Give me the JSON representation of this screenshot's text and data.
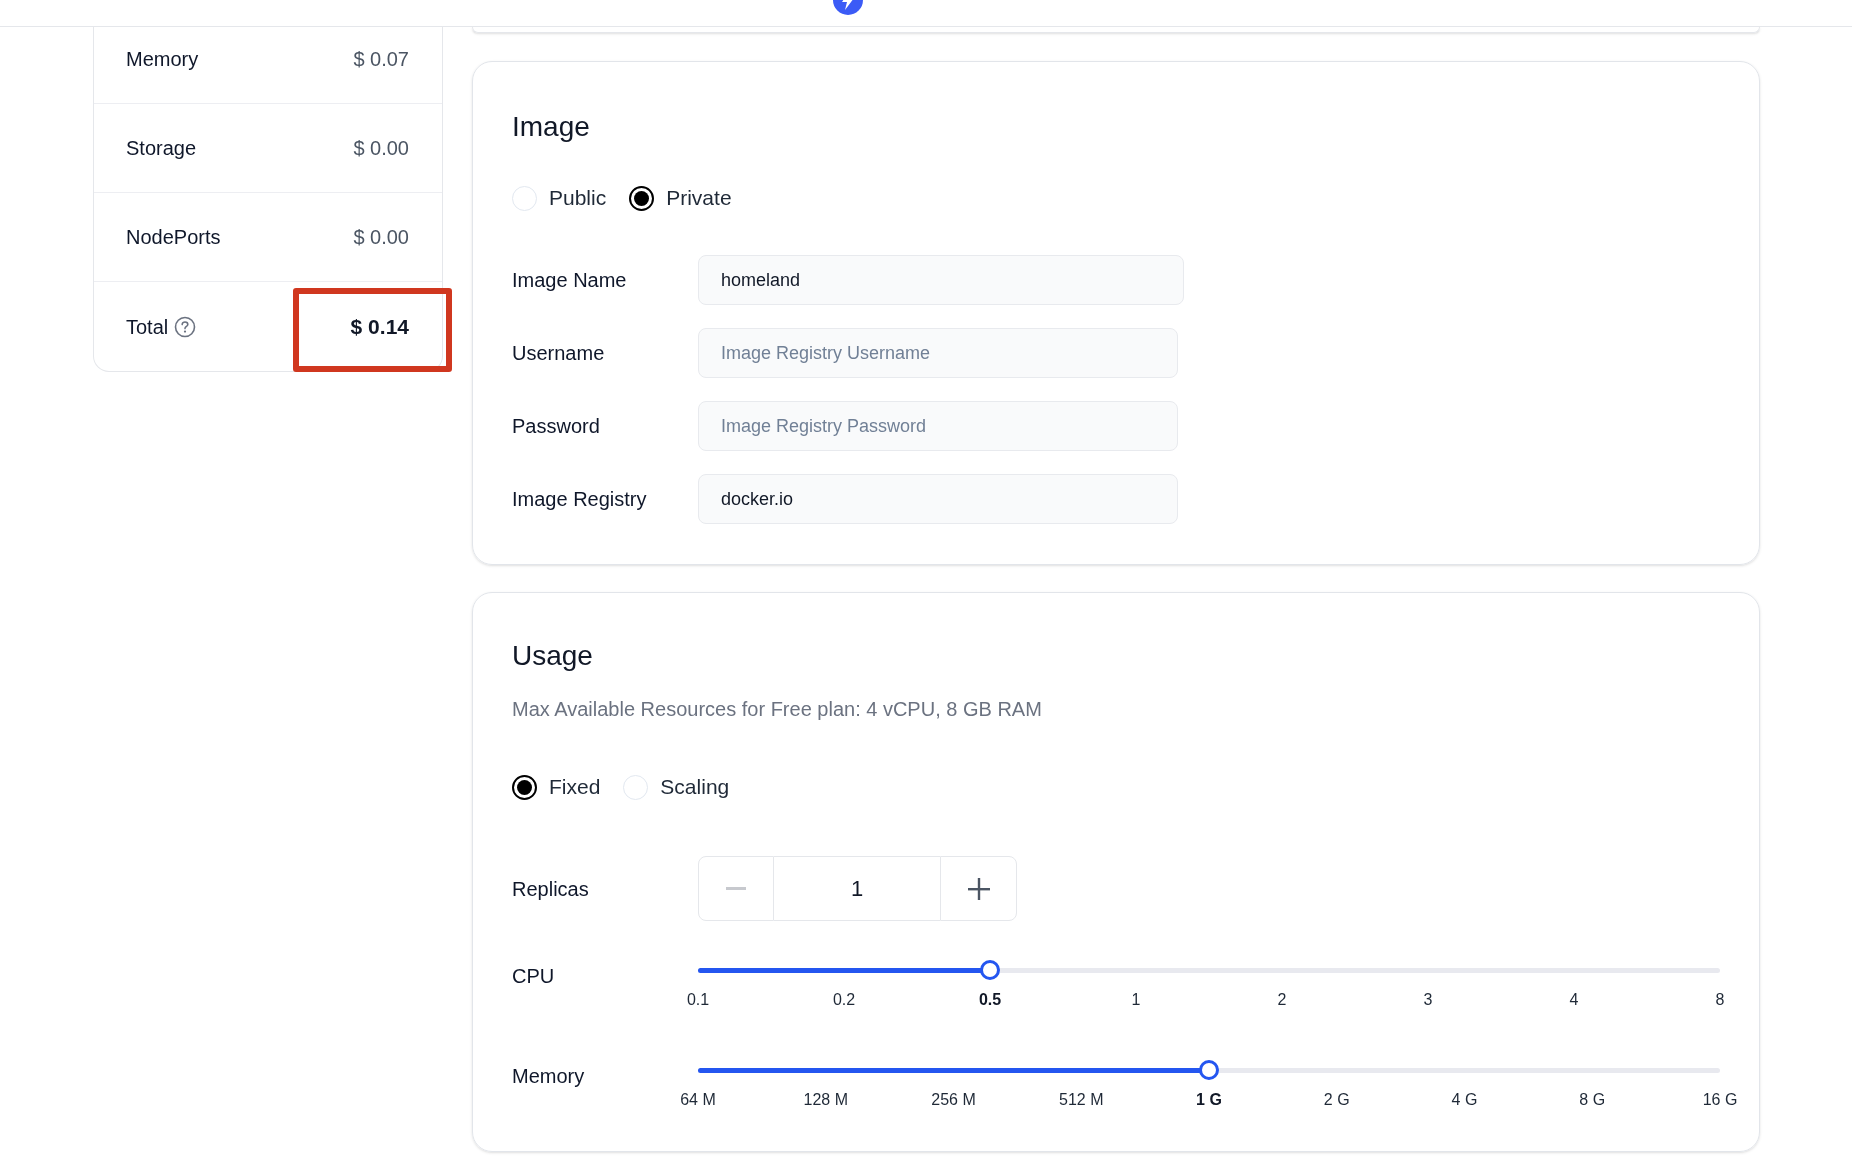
{
  "price_panel": {
    "rows": [
      {
        "label": "Memory",
        "value": "$ 0.07"
      },
      {
        "label": "Storage",
        "value": "$ 0.00"
      },
      {
        "label": "NodePorts",
        "value": "$ 0.00"
      }
    ],
    "total": {
      "label": "Total",
      "value": "$ 0.14",
      "highlighted": true
    }
  },
  "image_card": {
    "title": "Image",
    "access_options": [
      {
        "label": "Public",
        "selected": false
      },
      {
        "label": "Private",
        "selected": true
      }
    ],
    "fields": [
      {
        "label": "Image Name",
        "value": "homeland"
      },
      {
        "label": "Username",
        "placeholder": "Image Registry Username"
      },
      {
        "label": "Password",
        "placeholder": "Image Registry Password"
      },
      {
        "label": "Image Registry",
        "value": "docker.io"
      }
    ]
  },
  "usage_card": {
    "title": "Usage",
    "note": "Max Available Resources for Free plan: 4 vCPU, 8 GB RAM",
    "mode_options": [
      {
        "label": "Fixed",
        "selected": true
      },
      {
        "label": "Scaling",
        "selected": false
      }
    ],
    "replicas": {
      "label": "Replicas",
      "value": "1",
      "decrement_disabled": true
    },
    "sliders": [
      {
        "label": "CPU",
        "level": 0.2857,
        "ticks": [
          {
            "label": "0.1",
            "selected": false
          },
          {
            "label": "0.2",
            "selected": false
          },
          {
            "label": "0.5",
            "selected": true
          },
          {
            "label": "1",
            "selected": false
          },
          {
            "label": "2",
            "selected": false
          },
          {
            "label": "3",
            "selected": false
          },
          {
            "label": "4",
            "selected": false
          },
          {
            "label": "8",
            "selected": false
          }
        ]
      },
      {
        "label": "Memory",
        "level": 0.5,
        "ticks": [
          {
            "label": "64 M",
            "selected": false
          },
          {
            "label": "128 M",
            "selected": false
          },
          {
            "label": "256 M",
            "selected": false
          },
          {
            "label": "512 M",
            "selected": false
          },
          {
            "label": "1 G",
            "selected": true
          },
          {
            "label": "2 G",
            "selected": false
          },
          {
            "label": "4 G",
            "selected": false
          },
          {
            "label": "8 G",
            "selected": false
          },
          {
            "label": "16 G",
            "selected": false
          }
        ]
      }
    ]
  }
}
